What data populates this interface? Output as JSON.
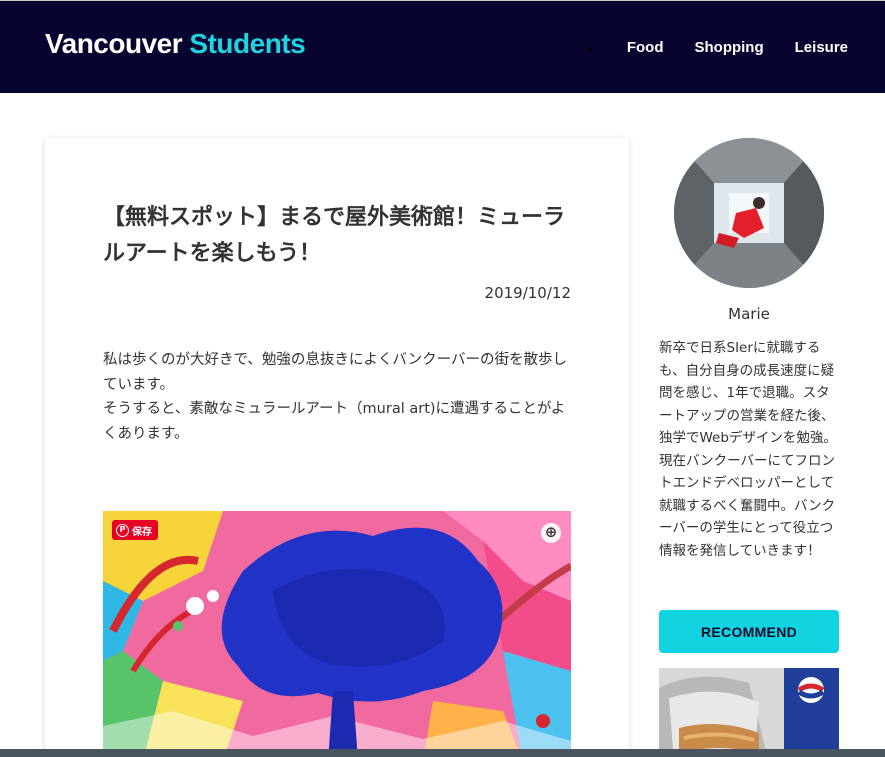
{
  "header": {
    "logo_main": "Vancouver",
    "logo_accent": "Students",
    "nav": [
      "Food",
      "Shopping",
      "Leisure"
    ]
  },
  "article": {
    "title": "【無料スポット】まるで屋外美術館！ミューラルアートを楽しもう！",
    "date": "2019/10/12",
    "paragraphs": [
      "私は歩くのが大好きで、勉強の息抜きによくバンクーバーの街を散歩しています。",
      "そうすると、素敵なミュラールアート（mural art)に遭遇することがよくあります。"
    ],
    "image": {
      "save_label": "保存",
      "pin_icon": "pinterest-icon",
      "expand_icon": "expand-icon"
    }
  },
  "sidebar": {
    "author_name": "Marie",
    "author_bio": "新卒で日系SIerに就職するも、自分自身の成長速度に疑問を感じ、1年で退職。スタートアップの営業を経た後、独学でWebデザインを勉強。現在バンクーバーにてフロントエンドデベロッパーとして就職するべく奮闘中。バンクーバーの学生にとって役立つ情報を発信していきます！",
    "recommend_label": "RECOMMEND"
  },
  "colors": {
    "header_bg": "#070530",
    "accent": "#1fd3e1",
    "recommend_bg": "#12d3e0",
    "pin_red": "#e60023"
  }
}
